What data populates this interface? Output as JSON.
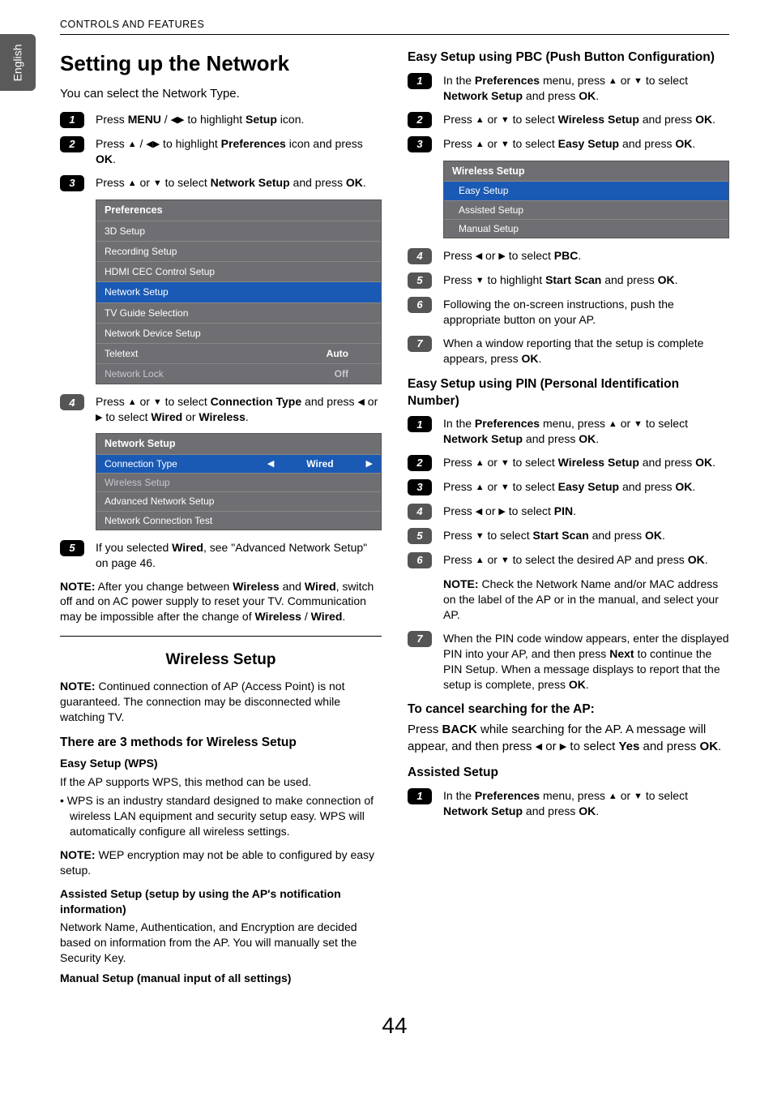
{
  "page": {
    "section_bar": "CONTROLS AND FEATURES",
    "lang_tab": "English",
    "page_number": "44"
  },
  "left": {
    "title": "Setting up the Network",
    "intro": "You can select the Network Type.",
    "steps": {
      "1": {
        "pre": "Press ",
        "b1": "MENU",
        "mid": " / ",
        "arr1": "◀▶",
        "mid2": " to highlight ",
        "b2": "Setup",
        "post": " icon."
      },
      "2": {
        "pre": "Press ",
        "arr1": "▲",
        "mid": " / ",
        "arr2": "◀▶",
        "mid2": " to highlight ",
        "b1": "Preferences",
        "post": " icon and press ",
        "b2": "OK",
        "end": "."
      },
      "3": {
        "pre": "Press ",
        "arr1": "▲",
        "mid": " or ",
        "arr2": "▼",
        "mid2": " to select ",
        "b1": "Network Setup",
        "post": " and press ",
        "b2": "OK",
        "end": "."
      },
      "4": {
        "pre": "Press ",
        "arr1": "▲",
        "mid": " or ",
        "arr2": "▼",
        "mid2": " to select ",
        "b1": "Connection Type",
        "post": " and press ",
        "arr3": "◀",
        "mid3": " or ",
        "arr4": "▶",
        "mid4": " to select ",
        "b2": "Wired",
        "or": " or ",
        "b3": "Wireless",
        "end": "."
      },
      "5": {
        "pre": "If you selected ",
        "b1": "Wired",
        "post": ", see \"Advanced Network Setup\" on page 46."
      }
    },
    "osd_prefs": {
      "title": "Preferences",
      "rows": [
        {
          "label": "3D Setup",
          "value": ""
        },
        {
          "label": "Recording Setup",
          "value": ""
        },
        {
          "label": "HDMI CEC Control Setup",
          "value": ""
        },
        {
          "label": "Network Setup",
          "value": "",
          "sel": true
        },
        {
          "label": "TV Guide Selection",
          "value": ""
        },
        {
          "label": "Network Device Setup",
          "value": ""
        },
        {
          "label": "Teletext",
          "value": "Auto"
        },
        {
          "label": "Network Lock",
          "value": "Off",
          "dim": true
        }
      ]
    },
    "osd_net": {
      "title": "Network Setup",
      "rows": [
        {
          "label": "Connection Type",
          "value": "Wired",
          "sel": true,
          "arrows": true
        },
        {
          "label": "Wireless Setup",
          "value": "",
          "dim": true
        },
        {
          "label": "Advanced Network Setup",
          "value": ""
        },
        {
          "label": "Network Connection Test",
          "value": ""
        }
      ]
    },
    "note1": {
      "b1": "NOTE:",
      "t1": "  After you change between ",
      "b2": "Wireless",
      "t2": " and ",
      "b3": "Wired",
      "t3": ", switch off and on AC power supply to reset your TV. Communication may be impossible after the change of ",
      "b4": "Wireless",
      "t4": " / ",
      "b5": "Wired",
      "t5": "."
    },
    "wireless_h": "Wireless Setup",
    "wireless_note": {
      "b1": "NOTE:",
      "t1": " Continued connection of AP (Access Point) is not guaranteed. The connection may be disconnected while watching TV."
    },
    "methods_h": "There are 3 methods for Wireless Setup",
    "easy_wps_h": "Easy Setup (WPS)",
    "easy_wps_p": "If the AP supports WPS, this method can be used.",
    "easy_wps_li": "WPS is an industry standard designed to make connection of wireless LAN equipment and security setup easy. WPS will automatically configure all wireless settings.",
    "easy_wps_note": {
      "b1": "NOTE:",
      "t1": "  WEP encryption may not be able to configured by easy setup."
    },
    "assisted_h": "Assisted Setup (setup by using the AP's notification information)",
    "assisted_p": "Network Name, Authentication, and Encryption are decided based on information from the AP. You will manually set the Security Key.",
    "manual_h": "Manual Setup (manual input of all settings)"
  },
  "right": {
    "pbc_h": "Easy Setup using PBC (Push Button Configuration)",
    "pbc": {
      "1": {
        "pre": "In the ",
        "b1": "Preferences",
        "mid": " menu, press ",
        "arr1": "▲",
        "or": " or ",
        "arr2": "▼",
        "mid2": " to select ",
        "b2": "Network Setup",
        "post": " and press ",
        "b3": "OK",
        "end": "."
      },
      "2": {
        "pre": "Press ",
        "arr1": "▲",
        "or": " or ",
        "arr2": "▼",
        "mid": " to select ",
        "b1": "Wireless Setup",
        "post": " and press ",
        "b2": "OK",
        "end": "."
      },
      "3": {
        "pre": "Press ",
        "arr1": "▲",
        "or": " or ",
        "arr2": "▼",
        "mid": " to select ",
        "b1": "Easy Setup",
        "post": " and press ",
        "b2": "OK",
        "end": "."
      },
      "4": {
        "pre": "Press ",
        "arr1": "◀",
        "or": " or ",
        "arr2": "▶",
        "mid": " to select ",
        "b1": "PBC",
        "end": "."
      },
      "5": {
        "pre": "Press ",
        "arr1": "▼",
        "mid": " to highlight ",
        "b1": "Start Scan",
        "post": " and press ",
        "b2": "OK",
        "end": "."
      },
      "6": {
        "txt": "Following the on-screen instructions, push the appropriate button on your AP."
      },
      "7": {
        "pre": "When a window reporting that the setup is complete appears, press ",
        "b1": "OK",
        "end": "."
      }
    },
    "osd_wireless": {
      "title": "Wireless Setup",
      "rows": [
        {
          "label": "Easy Setup",
          "sel": true
        },
        {
          "label": "Assisted Setup"
        },
        {
          "label": "Manual Setup"
        }
      ]
    },
    "pin_h": "Easy Setup using PIN (Personal Identification Number)",
    "pin": {
      "1": {
        "pre": "In the ",
        "b1": "Preferences",
        "mid": " menu, press ",
        "arr1": "▲",
        "or": " or ",
        "arr2": "▼",
        "mid2": " to select ",
        "b2": "Network Setup",
        "post": " and press ",
        "b3": "OK",
        "end": "."
      },
      "2": {
        "pre": "Press ",
        "arr1": "▲",
        "or": " or ",
        "arr2": "▼",
        "mid": " to select ",
        "b1": "Wireless Setup",
        "post": " and press ",
        "b2": "OK",
        "end": "."
      },
      "3": {
        "pre": "Press ",
        "arr1": "▲",
        "or": " or ",
        "arr2": "▼",
        "mid": " to select ",
        "b1": "Easy Setup",
        "post": " and press ",
        "b2": "OK",
        "end": "."
      },
      "4": {
        "pre": "Press ",
        "arr1": "◀",
        "or": " or ",
        "arr2": "▶",
        "mid": " to select ",
        "b1": "PIN",
        "end": "."
      },
      "5": {
        "pre": "Press ",
        "arr1": "▼",
        "mid": " to select ",
        "b1": "Start Scan",
        "post": " and press ",
        "b2": "OK",
        "end": "."
      },
      "6": {
        "pre": "Press ",
        "arr1": "▲",
        "or": " or ",
        "arr2": "▼",
        "mid": " to select the desired AP and press ",
        "b1": "OK",
        "end": "."
      },
      "6note": {
        "b1": "NOTE:",
        "t1": " Check the Network Name and/or  MAC address on the label of the AP or in the manual, and select your AP."
      },
      "7": {
        "pre": "When the PIN code window appears, enter the displayed PIN into your AP, and then press ",
        "b1": "Next",
        "mid": " to continue the PIN Setup. When a message displays to report that the setup is complete, press ",
        "b2": "OK",
        "end": "."
      }
    },
    "cancel_h": "To cancel searching for the AP:",
    "cancel": {
      "pre": "Press ",
      "b1": "BACK",
      "mid": " while searching for the AP. A message will appear, and then press ",
      "arr1": "◀",
      "or": " or ",
      "arr2": "▶",
      "mid2": " to select ",
      "b2": "Yes",
      "post": " and press ",
      "b3": "OK",
      "end": "."
    },
    "assisted2_h": "Assisted Setup",
    "assisted2": {
      "pre": "In the ",
      "b1": "Preferences",
      "mid": " menu, press ",
      "arr1": "▲",
      "or": " or ",
      "arr2": "▼",
      "mid2": " to select ",
      "b2": "Network Setup",
      "post": " and press ",
      "b3": "OK",
      "end": "."
    }
  }
}
